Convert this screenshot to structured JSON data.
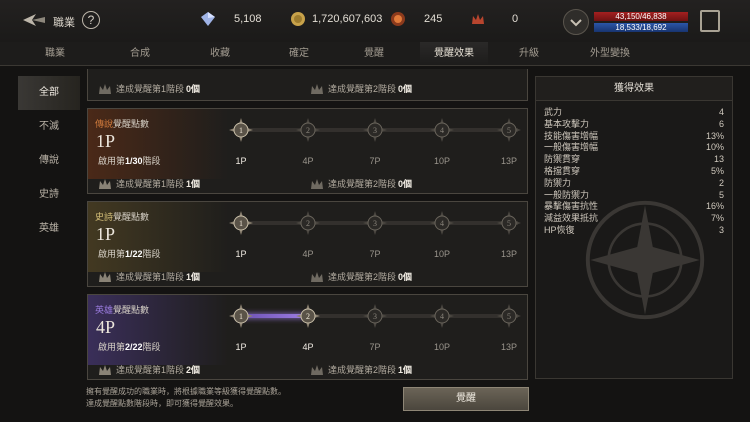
{
  "header": {
    "title": "職業",
    "help_label": "?",
    "currencies": [
      {
        "icon": "crystal-icon",
        "value": "5,108"
      },
      {
        "icon": "coin-icon",
        "value": "1,720,607,603"
      },
      {
        "icon": "orb-icon",
        "value": "245"
      },
      {
        "icon": "flame-crown-icon",
        "value": "0"
      }
    ],
    "hp": "43,150/46,838",
    "mp": "18,533/18,692"
  },
  "tabs": [
    "職業",
    "合成",
    "收藏",
    "確定",
    "覺醒",
    "覺醒效果",
    "升級",
    "外型變換"
  ],
  "active_tab": "覺醒效果",
  "sidebar": {
    "items": [
      "全部",
      "不滅",
      "傳說",
      "史詩",
      "英雄"
    ],
    "active": "全部"
  },
  "cards": [
    {
      "partial": true,
      "ach1_label": "達成覺醒第1階段",
      "ach1_count": "0個",
      "ach2_label": "達成覺醒第2階段",
      "ach2_count": "0個"
    },
    {
      "tier": "傳說",
      "title": "傳說覺醒點數",
      "points": "1P",
      "act_prefix": "啟用第",
      "act_value": "1/30",
      "act_suffix": "階段",
      "steps": [
        "1P",
        "4P",
        "7P",
        "10P",
        "13P"
      ],
      "progress": 0,
      "ach1_label": "達成覺醒第1階段",
      "ach1_count": "1個",
      "ach2_label": "達成覺醒第2階段",
      "ach2_count": "0個",
      "accent": "#d27b3c"
    },
    {
      "tier": "史詩",
      "title": "史詩覺醒點數",
      "points": "1P",
      "act_prefix": "啟用第",
      "act_value": "1/22",
      "act_suffix": "階段",
      "steps": [
        "1P",
        "4P",
        "7P",
        "10P",
        "13P"
      ],
      "progress": 0,
      "ach1_label": "達成覺醒第1階段",
      "ach1_count": "1個",
      "ach2_label": "達成覺醒第2階段",
      "ach2_count": "0個",
      "accent": "#d8c27a"
    },
    {
      "tier": "英雄",
      "title": "英雄覺醒點數",
      "points": "4P",
      "act_prefix": "啟用第",
      "act_value": "2/22",
      "act_suffix": "階段",
      "steps": [
        "1P",
        "4P",
        "7P",
        "10P",
        "13P"
      ],
      "progress": 1,
      "ach1_label": "達成覺醒第1階段",
      "ach1_count": "2個",
      "ach2_label": "達成覺醒第2階段",
      "ach2_count": "1個",
      "accent": "#9b7ce0"
    }
  ],
  "effects": {
    "title": "獲得效果",
    "stats": [
      {
        "name": "武力",
        "value": "4"
      },
      {
        "name": "基本攻擊力",
        "value": "6"
      },
      {
        "name": "技能傷害增幅",
        "value": "13%"
      },
      {
        "name": "一般傷害增幅",
        "value": "10%"
      },
      {
        "name": "防禦貫穿",
        "value": "13"
      },
      {
        "name": "格擋貫穿",
        "value": "5%"
      },
      {
        "name": "防禦力",
        "value": "2"
      },
      {
        "name": "一般防禦力",
        "value": "5"
      },
      {
        "name": "暴擊傷害抗性",
        "value": "16%"
      },
      {
        "name": "減益效果抵抗",
        "value": "7%"
      },
      {
        "name": "HP恢復",
        "value": "3"
      }
    ]
  },
  "footer": {
    "note_line1": "擁有覺醒成功的職業時，將根據職業等級獲得覺醒點數。",
    "note_line2": "達成覺醒點數階段時，即可獲得覺醒效果。",
    "awaken_button": "覺醒"
  },
  "colors": {
    "gold": "#d8c27a",
    "legend": "#d27b3c",
    "hero": "#9b7ce0"
  }
}
